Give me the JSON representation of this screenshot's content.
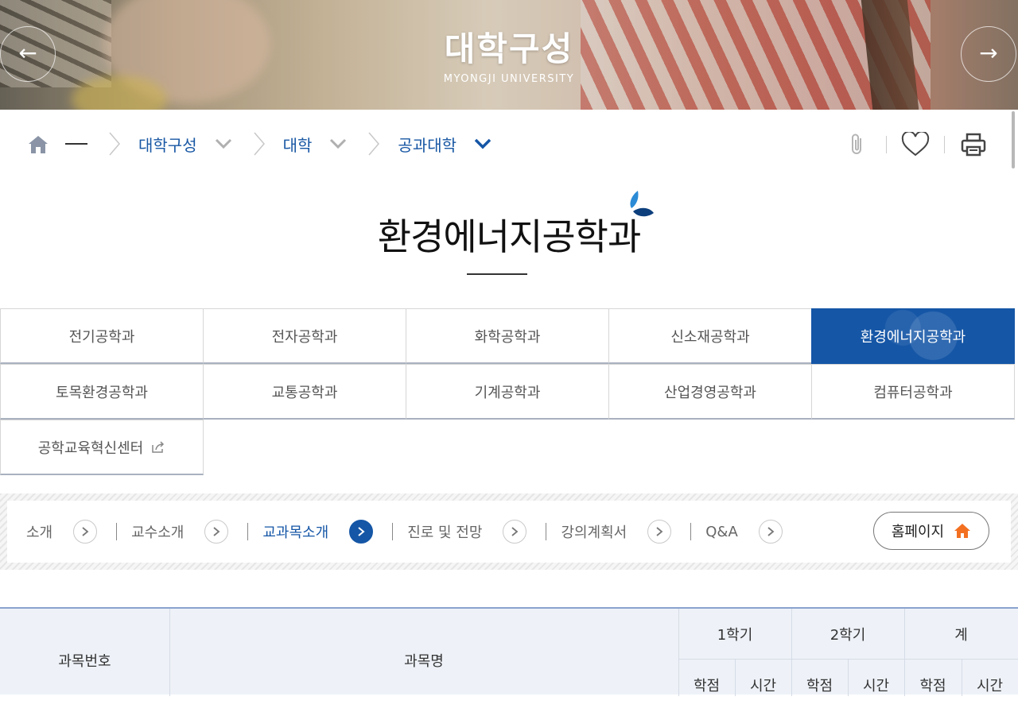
{
  "hero": {
    "title": "대학구성",
    "subtitle": "MYONGJI UNIVERSITY",
    "prev_label": "←",
    "next_label": "→"
  },
  "breadcrumb": {
    "items": [
      "대학구성",
      "대학",
      "공과대학"
    ]
  },
  "page": {
    "title": "환경에너지공학과"
  },
  "departments": [
    [
      "전기공학과",
      "전자공학과",
      "화학공학과",
      "신소재공학과",
      "환경에너지공학과"
    ],
    [
      "토목환경공학과",
      "교통공학과",
      "기계공학과",
      "산업경영공학과",
      "컴퓨터공학과"
    ],
    [
      "공학교육혁신센터"
    ]
  ],
  "active_department": "환경에너지공학과",
  "subnav": {
    "items": [
      "소개",
      "교수소개",
      "교과목소개",
      "진로 및 전망",
      "강의계획서",
      "Q&A"
    ],
    "active": "교과목소개",
    "homepage_label": "홈페이지"
  },
  "table": {
    "col_code": "과목번호",
    "col_name": "과목명",
    "sem1": "1학기",
    "sem2": "2학기",
    "total": "계",
    "credit": "학점",
    "hours": "시간"
  },
  "colors": {
    "primary": "#1556a6",
    "accent": "#f37021"
  },
  "icons": [
    "home-icon",
    "chevron-right-icon",
    "chevron-down-icon",
    "clip-icon",
    "heart-icon",
    "print-icon",
    "external-link-icon",
    "house-icon"
  ]
}
